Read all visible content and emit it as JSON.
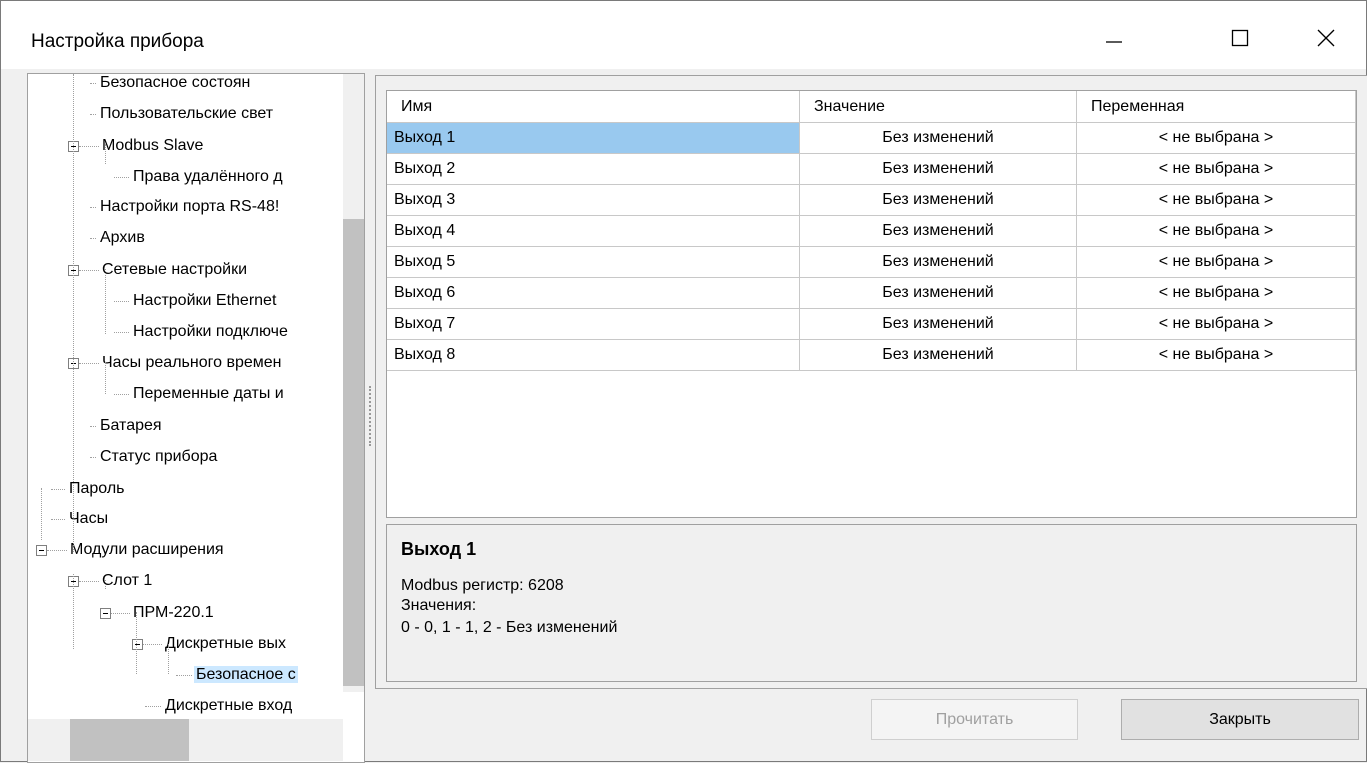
{
  "window": {
    "title": "Настройка прибора",
    "minimize_icon": "minimize-icon",
    "maximize_icon": "maximize-icon",
    "close_icon": "close-icon"
  },
  "tree": {
    "items": [
      {
        "label": "Безопасное состоян",
        "expandable": false,
        "selected": false
      },
      {
        "label": "Пользовательские свет",
        "expandable": false,
        "selected": false
      },
      {
        "label": "Modbus Slave",
        "expandable": true,
        "selected": false
      },
      {
        "label": "Права удалённого д",
        "expandable": false,
        "selected": false
      },
      {
        "label": "Настройки порта RS-48!",
        "expandable": false,
        "selected": false
      },
      {
        "label": "Архив",
        "expandable": false,
        "selected": false
      },
      {
        "label": "Сетевые настройки",
        "expandable": true,
        "selected": false
      },
      {
        "label": "Настройки Ethernet",
        "expandable": false,
        "selected": false
      },
      {
        "label": "Настройки подключе",
        "expandable": false,
        "selected": false
      },
      {
        "label": "Часы реального времен",
        "expandable": true,
        "selected": false
      },
      {
        "label": "Переменные даты и",
        "expandable": false,
        "selected": false
      },
      {
        "label": "Батарея",
        "expandable": false,
        "selected": false
      },
      {
        "label": "Статус прибора",
        "expandable": false,
        "selected": false
      },
      {
        "label": "Пароль",
        "expandable": false,
        "selected": false
      },
      {
        "label": "Часы",
        "expandable": false,
        "selected": false
      },
      {
        "label": "Модули расширения",
        "expandable": true,
        "selected": false
      },
      {
        "label": "Слот 1",
        "expandable": true,
        "selected": false
      },
      {
        "label": "ПРМ-220.1",
        "expandable": true,
        "selected": false
      },
      {
        "label": "Дискретные вых",
        "expandable": true,
        "selected": false
      },
      {
        "label": "Безопасное с",
        "expandable": false,
        "selected": true
      },
      {
        "label": "Дискретные вход",
        "expandable": false,
        "selected": false
      }
    ]
  },
  "table": {
    "columns": [
      "Имя",
      "Значение",
      "Переменная"
    ],
    "rows": [
      {
        "name": "Выход 1",
        "value": "Без изменений",
        "variable": "< не выбрана >"
      },
      {
        "name": "Выход 2",
        "value": "Без изменений",
        "variable": "< не выбрана >"
      },
      {
        "name": "Выход 3",
        "value": "Без изменений",
        "variable": "< не выбрана >"
      },
      {
        "name": "Выход 4",
        "value": "Без изменений",
        "variable": "< не выбрана >"
      },
      {
        "name": "Выход 5",
        "value": "Без изменений",
        "variable": "< не выбрана >"
      },
      {
        "name": "Выход 6",
        "value": "Без изменений",
        "variable": "< не выбрана >"
      },
      {
        "name": "Выход 7",
        "value": "Без изменений",
        "variable": "< не выбрана >"
      },
      {
        "name": "Выход 8",
        "value": "Без изменений",
        "variable": "< не выбрана >"
      }
    ]
  },
  "info": {
    "title": "Выход 1",
    "line1": "Modbus регистр: 6208",
    "line2": "Значения:",
    "line3": "0 - 0, 1 - 1, 2 - Без изменений"
  },
  "buttons": {
    "read": "Прочитать",
    "close": "Закрыть"
  },
  "colors": {
    "selection": "#99c9ef",
    "tree_selection": "#cce8ff"
  }
}
